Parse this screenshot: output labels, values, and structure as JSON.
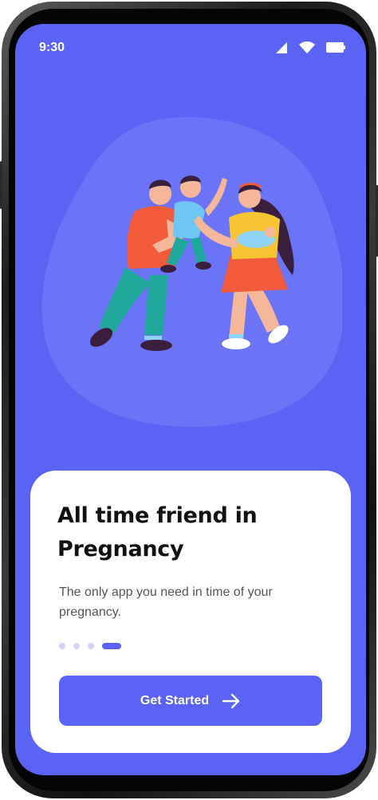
{
  "status_bar": {
    "time": "9:30",
    "icons": [
      "cellular-signal-icon",
      "wifi-icon",
      "battery-icon"
    ]
  },
  "illustration": {
    "subject": "family-illustration"
  },
  "onboarding": {
    "title": "All time friend in Pregnancy",
    "subtitle": "The only app you need in time of your pregnancy.",
    "page_indicator": {
      "total": 4,
      "active_index": 3
    },
    "cta_label": "Get Started",
    "cta_icon": "arrow-right-icon"
  },
  "colors": {
    "accent": "#5b63f4",
    "blob": "#6b74f7",
    "card": "#ffffff",
    "inactive_dot": "#d2d4fb"
  }
}
